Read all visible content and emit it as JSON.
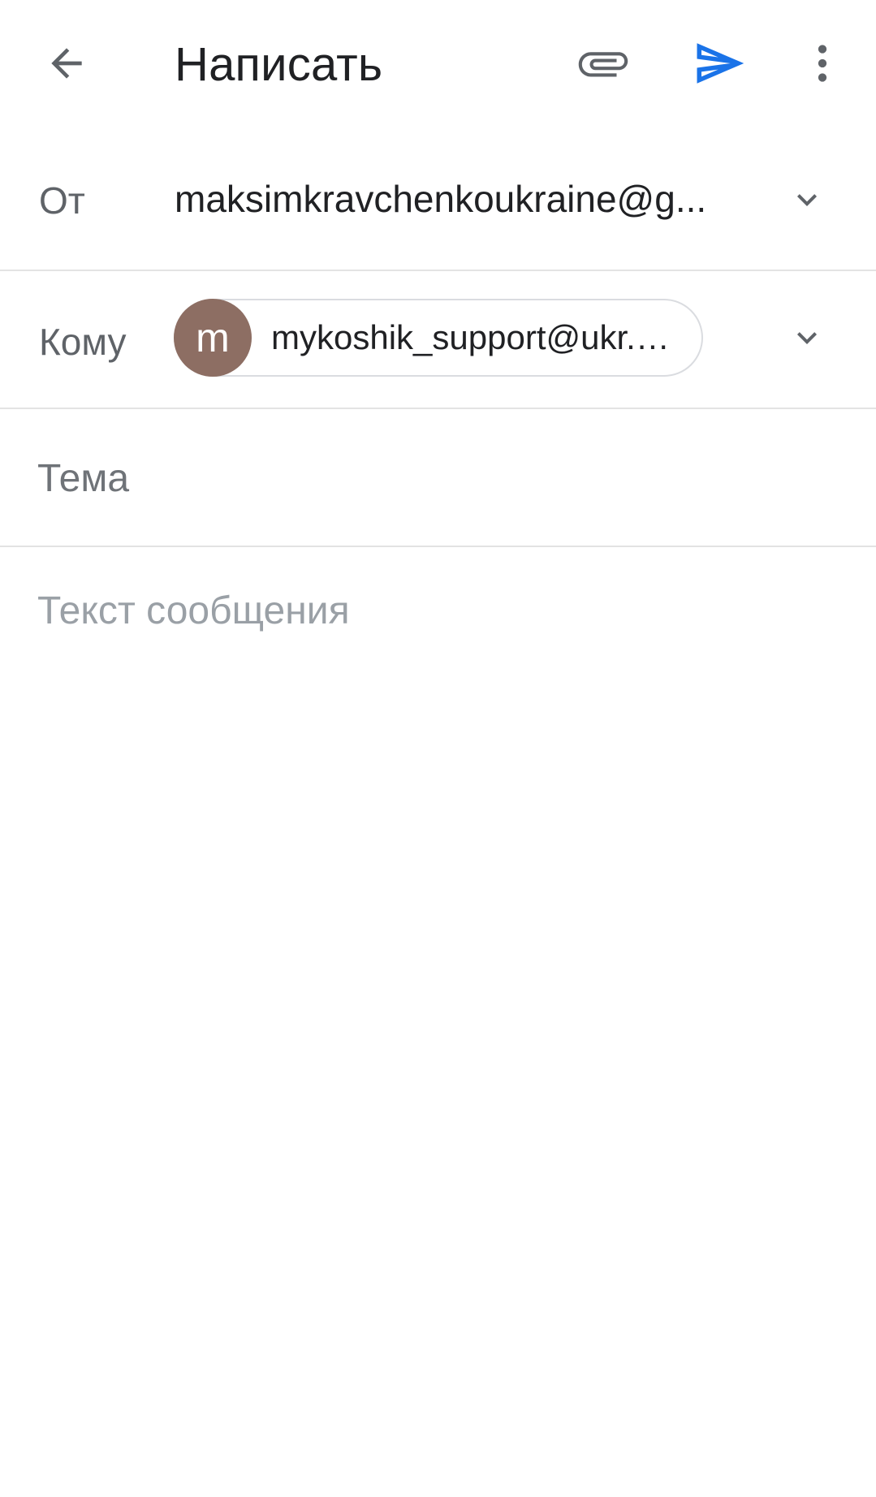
{
  "appbar": {
    "title": "Написать",
    "icons": {
      "back": "arrow-back-icon",
      "attach": "paperclip-icon",
      "send": "send-icon",
      "more": "more-vert-icon"
    },
    "colors": {
      "send_accent": "#1a73e8",
      "icon_gray": "#5f6368"
    }
  },
  "from": {
    "label": "От",
    "value": "maksimkravchenkoukraine@g..."
  },
  "to": {
    "label": "Кому",
    "recipient": {
      "avatar_letter": "m",
      "avatar_color": "#8d6e63",
      "email": "mykoshik_support@ukr.n..."
    }
  },
  "subject": {
    "placeholder": "Тема",
    "value": ""
  },
  "body": {
    "placeholder": "Текст сообщения",
    "value": ""
  }
}
